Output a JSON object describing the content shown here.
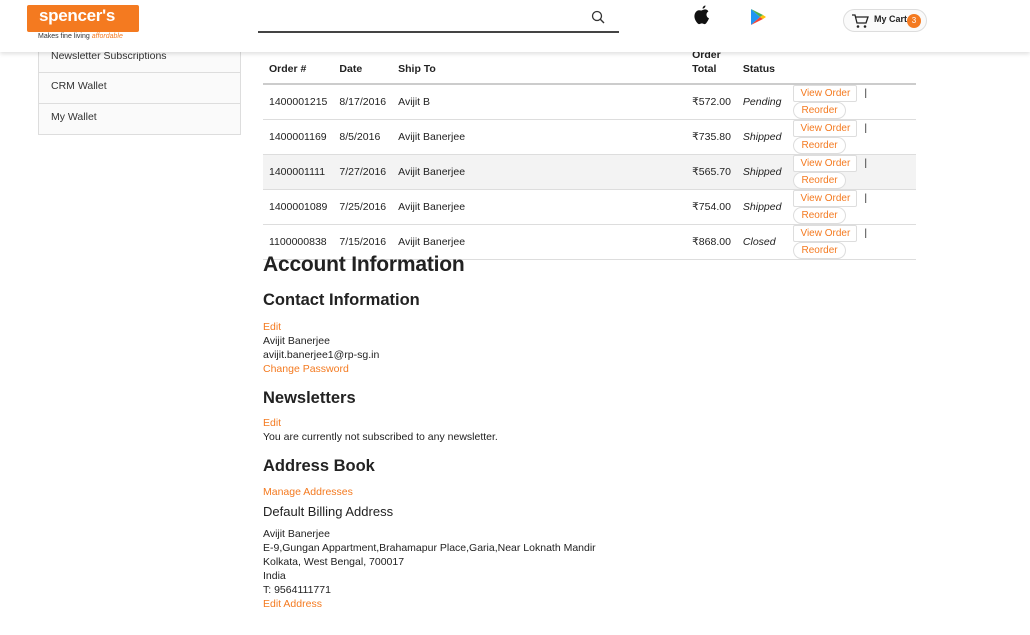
{
  "header": {
    "logo_name": "spencer's",
    "logo_tagline_plain": "Makes fine living",
    "logo_tagline_accent": "affordable",
    "search_value": "",
    "search_icon": "search-icon",
    "apple_icon": "apple-icon",
    "play_icon": "play-store-icon",
    "cart_label": "My Cart",
    "cart_count": "3",
    "accent_color": "#f47a20"
  },
  "sidebar": {
    "items": [
      {
        "label": "Newsletter Subscriptions"
      },
      {
        "label": "CRM Wallet"
      },
      {
        "label": "My Wallet"
      }
    ]
  },
  "orders": {
    "columns": {
      "order": "Order #",
      "date": "Date",
      "ship_to": "Ship To",
      "total_line1": "Order",
      "total_line2": "Total",
      "status": "Status"
    },
    "view_label": "View Order",
    "reorder_label": "Reorder",
    "separator": "|",
    "rows": [
      {
        "order": "1400001215",
        "date": "8/17/2016",
        "ship_to": "Avijit B",
        "total": "₹572.00",
        "status": "Pending"
      },
      {
        "order": "1400001169",
        "date": "8/5/2016",
        "ship_to": "Avijit Banerjee",
        "total": "₹735.80",
        "status": "Shipped"
      },
      {
        "order": "1400001111",
        "date": "7/27/2016",
        "ship_to": "Avijit Banerjee",
        "total": "₹565.70",
        "status": "Shipped"
      },
      {
        "order": "1400001089",
        "date": "7/25/2016",
        "ship_to": "Avijit Banerjee",
        "total": "₹754.00",
        "status": "Shipped"
      },
      {
        "order": "1100000838",
        "date": "7/15/2016",
        "ship_to": "Avijit Banerjee",
        "total": "₹868.00",
        "status": "Closed"
      }
    ]
  },
  "account": {
    "title": "Account Information",
    "contact": {
      "heading": "Contact Information",
      "edit_label": "Edit",
      "name": "Avijit Banerjee",
      "email": "avijit.banerjee1@rp-sg.in",
      "change_password_label": "Change Password"
    },
    "newsletters": {
      "heading": "Newsletters",
      "edit_label": "Edit",
      "message": "You are currently not subscribed to any newsletter."
    },
    "address_book": {
      "heading": "Address Book",
      "manage_label": "Manage Addresses",
      "billing_heading": "Default Billing Address",
      "name": "Avijit Banerjee",
      "line1": "E-9,Gungan Appartment,Brahamapur Place,Garia,Near Loknath Mandir",
      "line2": "Kolkata, West Bengal, 700017",
      "country": "India",
      "phone": "T: 9564111771",
      "edit_address_label": "Edit Address"
    }
  }
}
